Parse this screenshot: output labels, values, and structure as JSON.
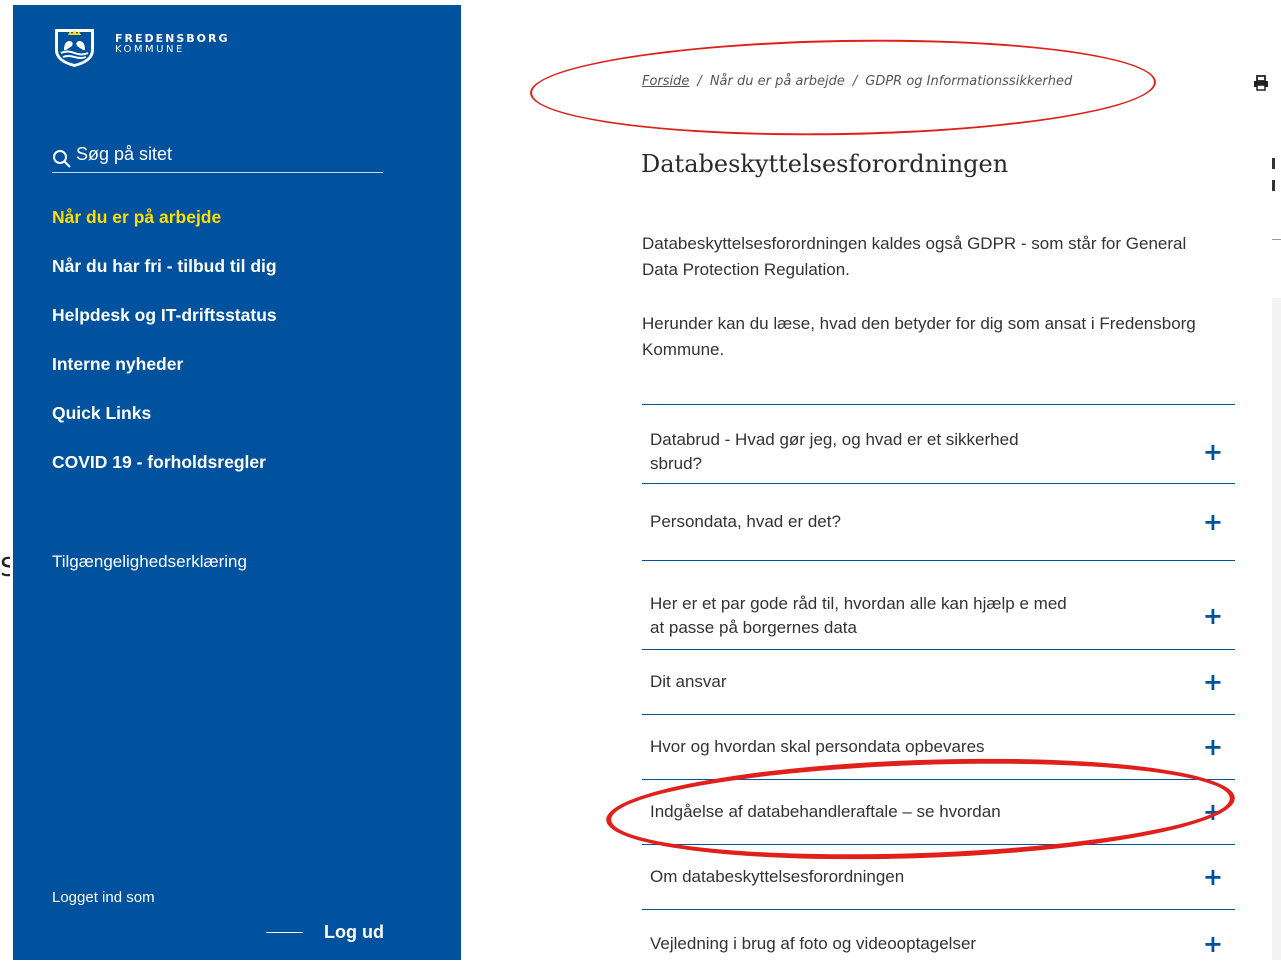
{
  "brand": {
    "name": "FREDENSBORG",
    "subtitle": "KOMMUNE"
  },
  "colors": {
    "sidebar": "#00519e",
    "active_nav": "#ffdd00",
    "accent": "#00519e",
    "annotation": "#e0201b"
  },
  "search": {
    "label": "Søg på sitet",
    "icon": "search-icon"
  },
  "nav": [
    {
      "label": "Når du er på arbejde",
      "active": true
    },
    {
      "label": "Når du har fri - tilbud til dig",
      "active": false
    },
    {
      "label": "Helpdesk og IT-driftsstatus",
      "active": false
    },
    {
      "label": "Interne nyheder",
      "active": false
    },
    {
      "label": "Quick Links",
      "active": false
    },
    {
      "label": "COVID 19 - forholdsregler",
      "active": false
    }
  ],
  "accessibility": {
    "label": "Tilgængelighedserklæring"
  },
  "account": {
    "logged_in_label": "Logget ind som",
    "logout_label": "Log ud"
  },
  "breadcrumb": [
    "Forside",
    "Når du er på arbejde",
    "GDPR og Informationssikkerhed"
  ],
  "page": {
    "title": "Databeskyttelsesforordningen",
    "intro_1": "Databeskyttelsesforordningen kaldes også GDPR - som står for General Data Protection Regulation.",
    "intro_2": "Herunder kan du læse, hvad den betyder for dig som ansat i Fredensborg Kommune."
  },
  "accordion": [
    {
      "label": "Databrud - Hvad gør jeg, og hvad er et sikkerhed sbrud?",
      "icon": "plus-icon"
    },
    {
      "label": "Persondata, hvad er det?",
      "icon": "plus-icon"
    },
    {
      "label": "Her er et par gode råd til, hvordan alle kan hjælp e med at passe på borgernes data",
      "icon": "plus-icon"
    },
    {
      "label": "Dit ansvar",
      "icon": "plus-icon"
    },
    {
      "label": "Hvor og hvordan skal persondata opbevares",
      "icon": "plus-icon"
    },
    {
      "label": "Indgåelse af databehandleraftale – se hvordan",
      "icon": "plus-icon"
    },
    {
      "label": "Om databeskyttelsesforordningen",
      "icon": "plus-icon"
    },
    {
      "label": "Vejledning i brug af foto og videooptagelser",
      "icon": "plus-icon"
    }
  ],
  "plus_glyph": "+",
  "breadcrumb_sep": "/",
  "edge_glyph": "S"
}
